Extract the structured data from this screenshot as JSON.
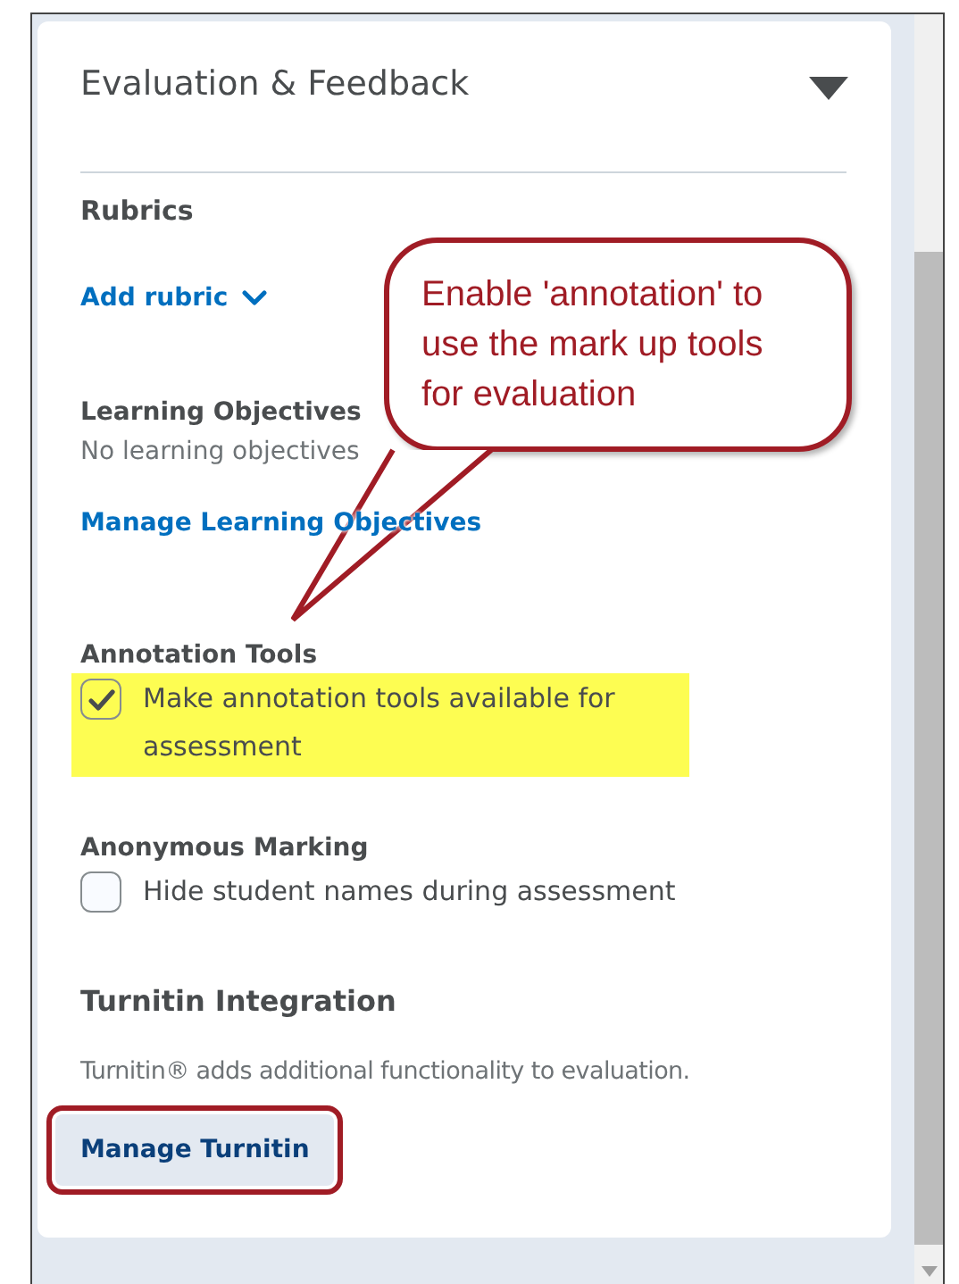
{
  "panel": {
    "title": "Evaluation & Feedback",
    "expanded": true
  },
  "sections": [
    {
      "kind": "link",
      "heading": "Rubrics",
      "link": "Add rubric"
    },
    {
      "kind": "info",
      "heading": "Learning Objectives",
      "text": "No learning objectives",
      "link": "Manage Learning Objectives"
    },
    {
      "kind": "checkbox",
      "heading": "Annotation Tools",
      "label": "Make annotation tools available for assessment",
      "checked": true,
      "highlighted": true
    },
    {
      "kind": "checkbox",
      "heading": "Anonymous Marking",
      "label": "Hide student names during assessment",
      "checked": false,
      "highlighted": false
    },
    {
      "kind": "button",
      "heading": "Turnitin Integration",
      "text": "Turnitin® adds additional functionality to evaluation.",
      "button": "Manage Turnitin",
      "outlined": true
    }
  ],
  "callout": {
    "text": "Enable 'annotation' to use the mark up tools for evaluation"
  }
}
